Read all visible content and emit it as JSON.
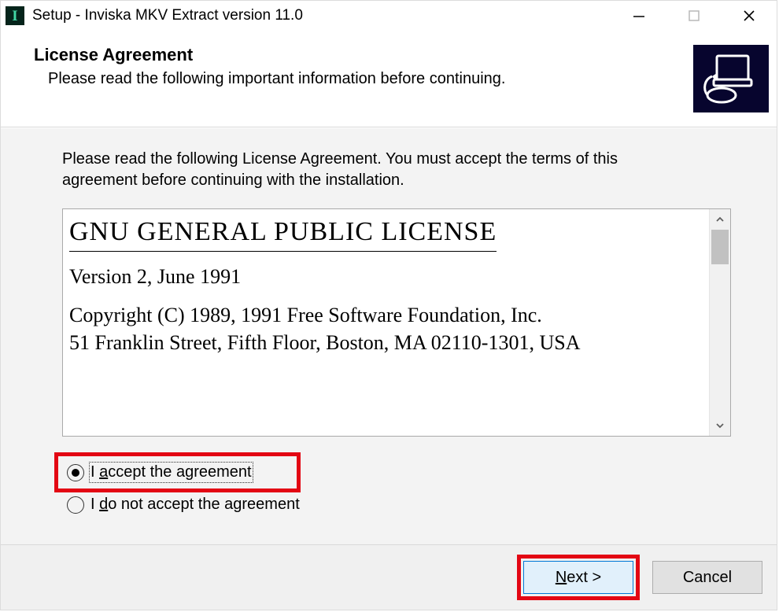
{
  "titlebar": {
    "app_icon_letter": "I",
    "title": "Setup - Inviska MKV Extract version 11.0"
  },
  "header": {
    "heading": "License Agreement",
    "subheading": "Please read the following important information before continuing."
  },
  "body": {
    "instructions": "Please read the following License Agreement. You must accept the terms of this agreement before continuing with the installation.",
    "license": {
      "title": "GNU GENERAL PUBLIC LICENSE",
      "version_line": "Version 2, June 1991",
      "copyright_line": "Copyright (C) 1989, 1991 Free Software Foundation, Inc.",
      "address_line": "51 Franklin Street, Fifth Floor, Boston, MA  02110-1301, USA"
    },
    "radios": {
      "accept_prefix": "I ",
      "accept_ul": "a",
      "accept_rest": "ccept the agreement",
      "reject_prefix": "I ",
      "reject_ul": "d",
      "reject_rest": "o not accept the agreement",
      "selected": "accept"
    }
  },
  "footer": {
    "next_ul": "N",
    "next_rest": "ext >",
    "cancel": "Cancel"
  }
}
